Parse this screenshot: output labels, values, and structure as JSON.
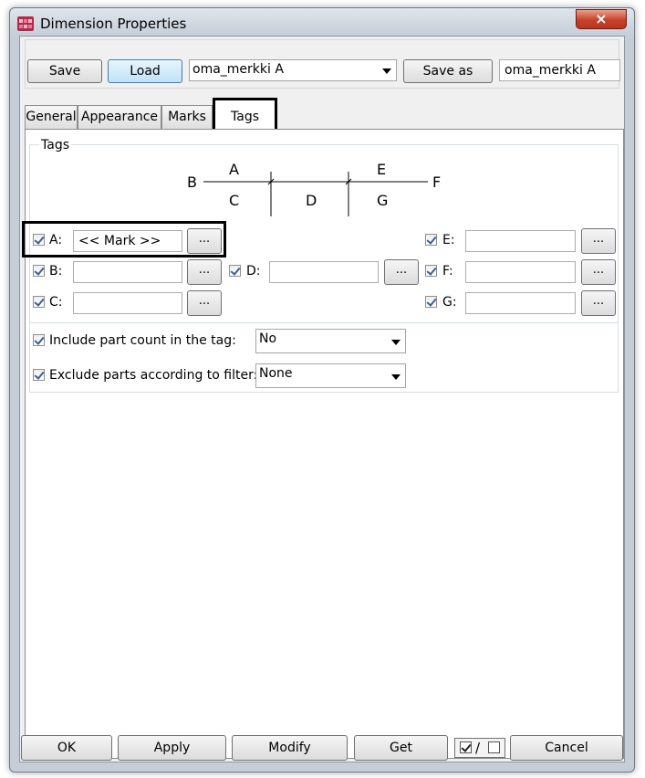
{
  "window": {
    "title": "Dimension Properties",
    "close_icon": "×"
  },
  "toolbar": {
    "save_label": "Save",
    "load_label": "Load",
    "preset_value": "oma_merkki A",
    "save_as_label": "Save as",
    "save_as_value": "oma_merkki A"
  },
  "tabs": [
    {
      "label": "General"
    },
    {
      "label": "Appearance"
    },
    {
      "label": "Marks"
    },
    {
      "label": "Tags"
    }
  ],
  "tags": {
    "group_title": "Tags",
    "diagram": {
      "A": "A",
      "B": "B",
      "C": "C",
      "D": "D",
      "E": "E",
      "F": "F",
      "G": "G"
    },
    "fields": {
      "A": {
        "label": "A:",
        "value": "<< Mark >>",
        "checked": true
      },
      "B": {
        "label": "B:",
        "value": "",
        "checked": true
      },
      "C": {
        "label": "C:",
        "value": "",
        "checked": true
      },
      "D": {
        "label": "D:",
        "value": "",
        "checked": true
      },
      "E": {
        "label": "E:",
        "value": "",
        "checked": true
      },
      "F": {
        "label": "F:",
        "value": "",
        "checked": true
      },
      "G": {
        "label": "G:",
        "value": "",
        "checked": true
      }
    },
    "browse_label": "...",
    "include_part_count": {
      "label": "Include part count in the tag:",
      "value": "No",
      "checked": true
    },
    "exclude_parts": {
      "label": "Exclude parts according to filter:",
      "value": "None",
      "checked": true
    }
  },
  "footer": {
    "ok_label": "OK",
    "apply_label": "Apply",
    "modify_label": "Modify",
    "get_label": "Get",
    "toggle_slash": "/",
    "cancel_label": "Cancel"
  }
}
